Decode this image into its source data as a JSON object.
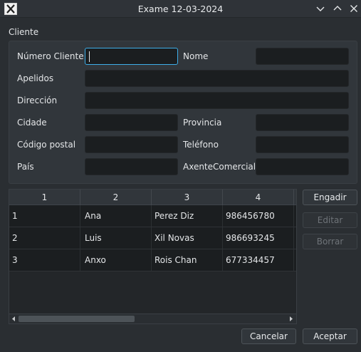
{
  "window": {
    "title": "Exame 12-03-2024"
  },
  "icons": {
    "app": "x-app-icon",
    "minimize": "chevron-down-icon",
    "maximize": "chevron-up-icon",
    "close": "close-icon"
  },
  "group": {
    "title": "Cliente"
  },
  "form": {
    "numero_cliente": {
      "label": "Número Cliente",
      "value": ""
    },
    "nome": {
      "label": "Nome",
      "value": ""
    },
    "apelidos": {
      "label": "Apelidos",
      "value": ""
    },
    "direccion": {
      "label": "Dirección",
      "value": ""
    },
    "cidade": {
      "label": "Cidade",
      "value": ""
    },
    "provincia": {
      "label": "Provincia",
      "value": ""
    },
    "codigo_postal": {
      "label": "Código postal",
      "value": ""
    },
    "telefono": {
      "label": "Teléfono",
      "value": ""
    },
    "pais": {
      "label": "País",
      "value": ""
    },
    "axente_comercial": {
      "label": "AxenteComercial",
      "value": ""
    }
  },
  "table": {
    "headers": [
      "1",
      "2",
      "3",
      "4"
    ],
    "rows": [
      [
        "1",
        "Ana",
        "Perez Diz",
        "986456780"
      ],
      [
        "2",
        "Luis",
        "Xil Novas",
        "986693245"
      ],
      [
        "3",
        "Anxo",
        "Rois Chan",
        "677334457"
      ]
    ]
  },
  "actions": {
    "engadir": "Engadir",
    "editar": "Editar",
    "borrar": "Borrar"
  },
  "footer": {
    "cancelar": "Cancelar",
    "aceptar": "Aceptar"
  },
  "colors": {
    "accent": "#3daee9",
    "background": "#2a2e32",
    "field": "#1b1e20"
  }
}
